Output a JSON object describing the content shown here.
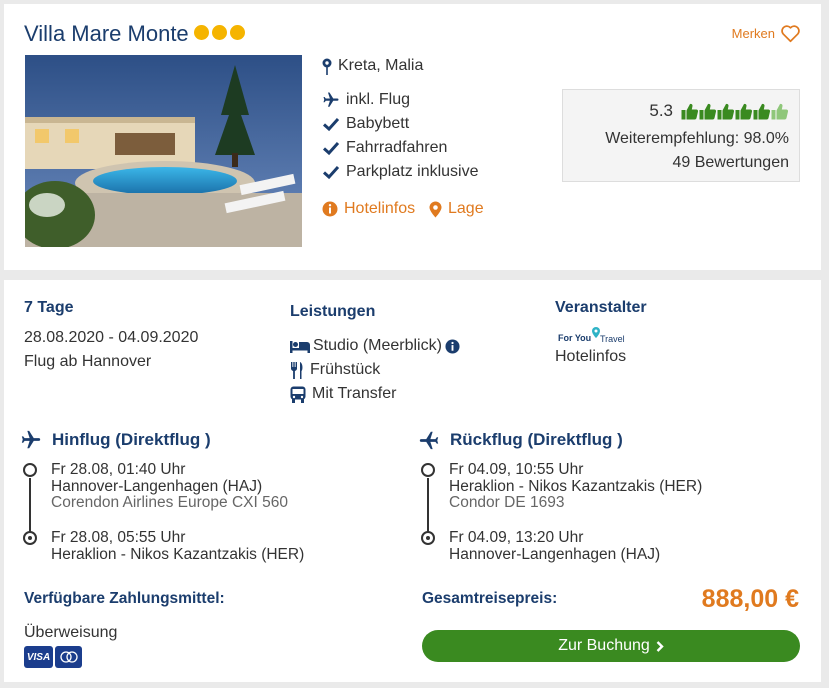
{
  "hotel": {
    "name": "Villa Mare Monte",
    "location": "Kreta, Malia",
    "merken_label": "Merken",
    "features": [
      {
        "icon": "plane-icon",
        "label": "inkl. Flug"
      },
      {
        "icon": "check-icon",
        "label": "Babybett"
      },
      {
        "icon": "check-icon",
        "label": "Fahrradfahren"
      },
      {
        "icon": "check-icon",
        "label": "Parkplatz inklusive"
      }
    ],
    "hotelinfos_link": "Hotelinfos",
    "lage_link": "Lage",
    "stars_count": 3,
    "accent_color": "#e07a1f",
    "star_color": "#f5b400"
  },
  "rating": {
    "score": "5.3",
    "thumbs_count": 6,
    "recommendation": "Weiterempfehlung: 98.0%",
    "reviews": "49 Bewertungen"
  },
  "offer": {
    "duration": "7 Tage",
    "dates": "28.08.2020 - 04.09.2020",
    "departure": "Flug ab Hannover",
    "services_heading": "Leistungen",
    "services": [
      {
        "icon": "bed-icon",
        "label": "Studio (Meerblick)"
      },
      {
        "icon": "cutlery-icon",
        "label": "Frühstück"
      },
      {
        "icon": "bus-icon",
        "label": "Mit Transfer"
      }
    ],
    "operator_heading": "Veranstalter",
    "operator_logo_text": "For You Travel",
    "operator_link": "Hotelinfos"
  },
  "outbound": {
    "title": "Hinflug (Direktflug )",
    "dep_time": "Fr 28.08, 01:40 Uhr",
    "dep_airport": "Hannover-Langenhagen (HAJ)",
    "airline": "Corendon Airlines Europe CXI 560",
    "arr_time": "Fr 28.08, 05:55 Uhr",
    "arr_airport": "Heraklion - Nikos Kazantzakis (HER)"
  },
  "inbound": {
    "title": "Rückflug (Direktflug )",
    "dep_time": "Fr 04.09, 10:55 Uhr",
    "dep_airport": "Heraklion - Nikos Kazantzakis (HER)",
    "airline": "Condor DE 1693",
    "arr_time": "Fr 04.09, 13:20 Uhr",
    "arr_airport": "Hannover-Langenhagen (HAJ)"
  },
  "payment": {
    "heading": "Verfügbare Zahlungsmittel:",
    "method": "Überweisung",
    "visa_label": "VISA"
  },
  "total": {
    "label": "Gesamtreisepreis:",
    "price": "888,00 €",
    "button": "Zur Buchung"
  },
  "colors": {
    "navy": "#1b3d6d",
    "button_green": "#3a8a20",
    "thumb_green": "#3a8a20"
  }
}
